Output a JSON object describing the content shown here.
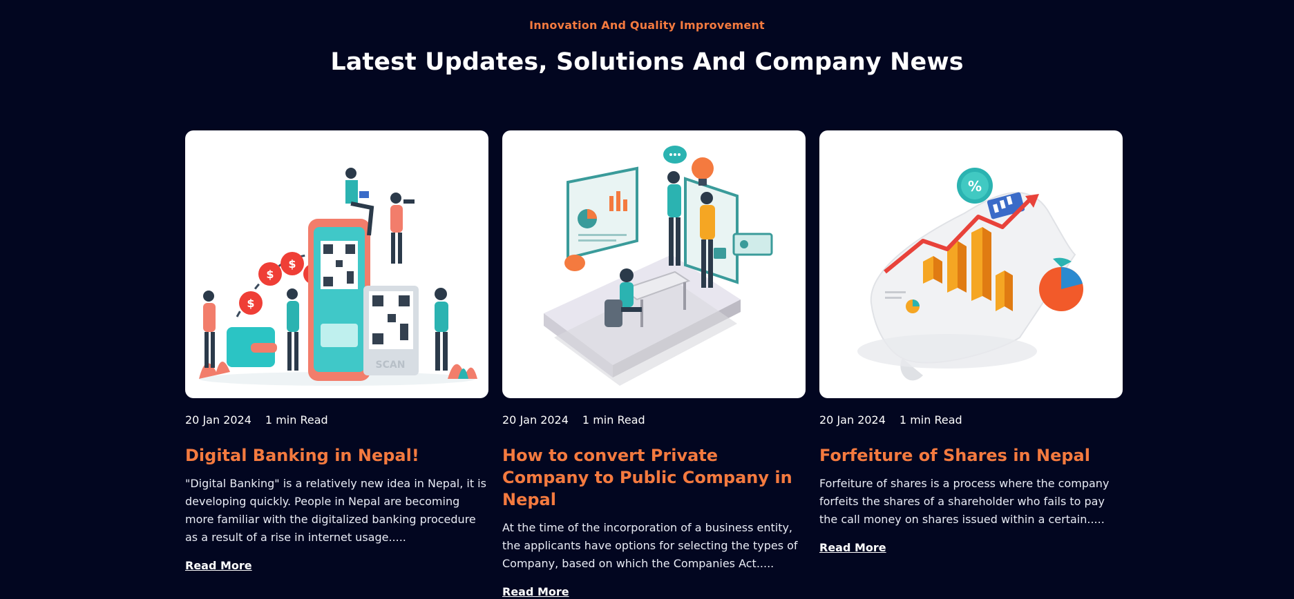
{
  "header": {
    "eyebrow": "Innovation And Quality Improvement",
    "title": "Latest Updates, Solutions And Company News"
  },
  "colors": {
    "background": "#020620",
    "accent": "#f47a3f",
    "text": "#ffffff"
  },
  "posts": [
    {
      "date": "20 Jan 2024",
      "read_time": "1 min Read",
      "title": "Digital Banking in Nepal!",
      "excerpt": "\"Digital Banking\" is a relatively new idea in Nepal, it is developing quickly. People in Nepal are becoming more familiar with the digitalized banking procedure as a result of a rise in internet usage.....",
      "read_more": "Read More",
      "image_label": "SCAN",
      "image_icon": "digital-banking-illustration"
    },
    {
      "date": "20 Jan 2024",
      "read_time": "1 min Read",
      "title": "How to convert Private Company to Public Company in Nepal",
      "excerpt": "At the time of the incorporation of a business entity, the applicants have options for selecting the types of Company, based on which the Companies Act.....",
      "read_more": "Read More",
      "image_icon": "office-meeting-illustration"
    },
    {
      "date": "20 Jan 2024",
      "read_time": "1 min Read",
      "title": "Forfeiture of Shares in Nepal",
      "excerpt": "Forfeiture of shares is a process where the company forfeits the shares of a shareholder who fails to pay the call money on shares issued within a certain.....",
      "read_more": "Read More",
      "image_label": "%",
      "image_icon": "financial-growth-illustration"
    }
  ]
}
